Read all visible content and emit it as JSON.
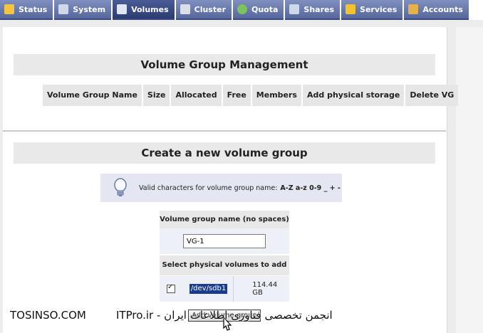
{
  "tabs": [
    {
      "label": "Status",
      "icon": "status-icon",
      "color": "#f5c542"
    },
    {
      "label": "System",
      "icon": "system-icon",
      "color": "#cfd8e8"
    },
    {
      "label": "Volumes",
      "icon": "volumes-icon",
      "color": "#dfe6f2",
      "active": true
    },
    {
      "label": "Cluster",
      "icon": "cluster-icon",
      "color": "#d9dee8"
    },
    {
      "label": "Quota",
      "icon": "quota-icon",
      "color": "#7cc35b"
    },
    {
      "label": "Shares",
      "icon": "shares-icon",
      "color": "#cfd8e8"
    },
    {
      "label": "Services",
      "icon": "services-icon",
      "color": "#f2c230"
    },
    {
      "label": "Accounts",
      "icon": "accounts-icon",
      "color": "#e6b04a"
    }
  ],
  "vg_management": {
    "title": "Volume Group Management",
    "columns": [
      "Volume Group Name",
      "Size",
      "Allocated",
      "Free",
      "Members",
      "Add physical storage",
      "Delete VG"
    ]
  },
  "create_vg": {
    "title": "Create a new volume group",
    "note_text": "Valid characters for volume group name:",
    "note_chars": "A-Z a-z 0-9 _ + -",
    "name_label": "Volume group name (no spaces)",
    "name_value": "VG-1",
    "pv_label": "Select physical volumes to add",
    "pv_rows": [
      {
        "device": "/dev/sdb1",
        "size": "114.44 GB",
        "checked": true
      }
    ],
    "add_button": "Add volume group"
  },
  "watermark": {
    "left": "TOSINSO.COM",
    "right": "ITPro.ir - انجمن تخصصی فناوری اطلاعات ایران"
  },
  "colors": {
    "tab_bg": "#56679d",
    "tab_active": "#2c3c73",
    "section_bg": "#e9e9e9",
    "note_bg": "#e4e7f1",
    "selection": "#1a3c8e"
  }
}
